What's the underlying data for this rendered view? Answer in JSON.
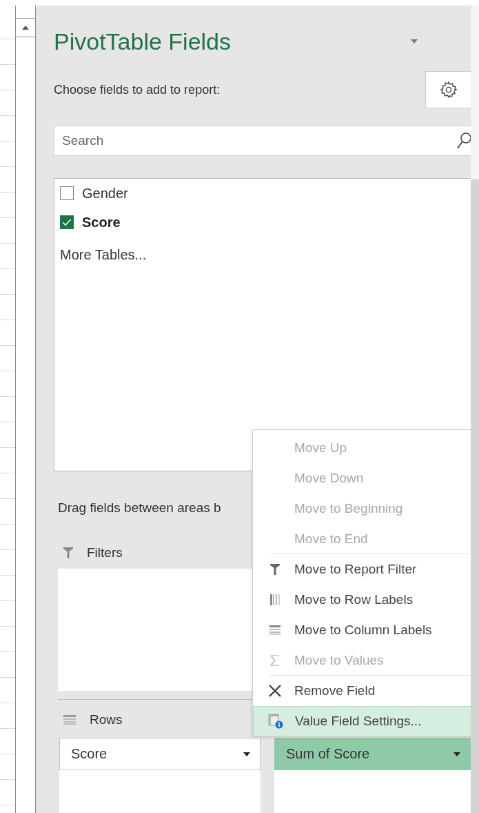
{
  "panel": {
    "title": "PivotTable Fields",
    "instruction": "Choose fields to add to report:"
  },
  "search": {
    "placeholder": "Search"
  },
  "fields": [
    {
      "label": "Gender",
      "checked": false
    },
    {
      "label": "Score",
      "checked": true
    }
  ],
  "more_tables": "More Tables...",
  "areas_hint": "Drag fields between areas b",
  "filters_area": {
    "title": "Filters"
  },
  "rows_area": {
    "title": "Rows",
    "items": [
      {
        "label": "Score",
        "selected": false
      }
    ]
  },
  "values_area": {
    "items": [
      {
        "label": "Sum of Score",
        "selected": true
      }
    ]
  },
  "context_menu": [
    {
      "label": "Move Up",
      "kind": "plain",
      "disabled": true,
      "highlighted": false,
      "separator_after": false
    },
    {
      "label": "Move Down",
      "kind": "plain",
      "disabled": true,
      "highlighted": false,
      "separator_after": false
    },
    {
      "label": "Move to Beginning",
      "kind": "plain",
      "disabled": true,
      "highlighted": false,
      "separator_after": false
    },
    {
      "label": "Move to End",
      "kind": "plain",
      "disabled": true,
      "highlighted": false,
      "separator_after": true
    },
    {
      "label": "Move to Report Filter",
      "kind": "filter",
      "disabled": false,
      "highlighted": false,
      "separator_after": false
    },
    {
      "label": "Move to Row Labels",
      "kind": "rows",
      "disabled": false,
      "highlighted": false,
      "separator_after": false
    },
    {
      "label": "Move to Column Labels",
      "kind": "columns",
      "disabled": false,
      "highlighted": false,
      "separator_after": false
    },
    {
      "label": "Move to Values",
      "kind": "sigma",
      "disabled": true,
      "highlighted": false,
      "separator_after": true
    },
    {
      "label": "Remove Field",
      "kind": "remove",
      "disabled": false,
      "highlighted": false,
      "separator_after": false
    },
    {
      "label": "Value Field Settings...",
      "kind": "settings",
      "disabled": false,
      "highlighted": true,
      "separator_after": false
    }
  ]
}
